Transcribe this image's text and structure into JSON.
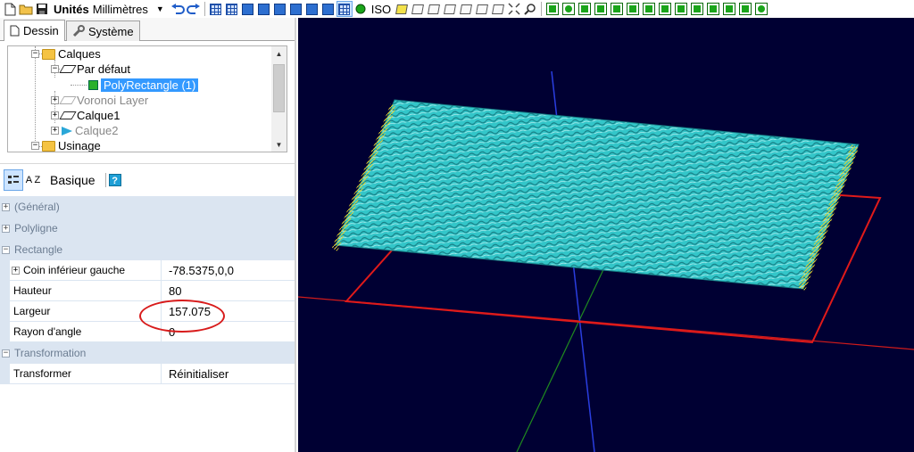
{
  "toolbar": {
    "units_label": "Unités",
    "units_value": "Millimètres",
    "iso_label": "ISO"
  },
  "tabs": [
    {
      "label": "Dessin",
      "icon": "document-icon",
      "active": true
    },
    {
      "label": "Système",
      "icon": "wrench-icon",
      "active": false
    }
  ],
  "tree": {
    "calques": "Calques",
    "par_defaut": "Par défaut",
    "polyrectangle": "PolyRectangle (1)",
    "voronoi": "Voronoi Layer",
    "calque1": "Calque1",
    "calque2": "Calque2",
    "usinage": "Usinage"
  },
  "properties_toolbar": {
    "sort_alpha_label": "A Z",
    "mode_label": "Basique",
    "help_label": "?"
  },
  "properties": {
    "general": "(Général)",
    "polyligne": "Polyligne",
    "rectangle": "Rectangle",
    "transformation": "Transformation",
    "rows": {
      "coin": {
        "name": "Coin inférieur gauche",
        "value": "-78.5375,0,0"
      },
      "hauteur": {
        "name": "Hauteur",
        "value": "80"
      },
      "largeur": {
        "name": "Largeur",
        "value": "157.075"
      },
      "rayon": {
        "name": "Rayon d'angle",
        "value": "0"
      },
      "transformer": {
        "name": "Transformer",
        "value": "Réinitialiser"
      }
    }
  },
  "colors": {
    "viewport_bg": "#000033",
    "surface": "#33c6c9",
    "surface_dark": "#167d84",
    "outline": "#e01a1a",
    "axis_x": "#d11b1b",
    "axis_y": "#1f8a1f",
    "axis_z": "#2a3ee0",
    "edge_hatch": "#e8d530"
  }
}
